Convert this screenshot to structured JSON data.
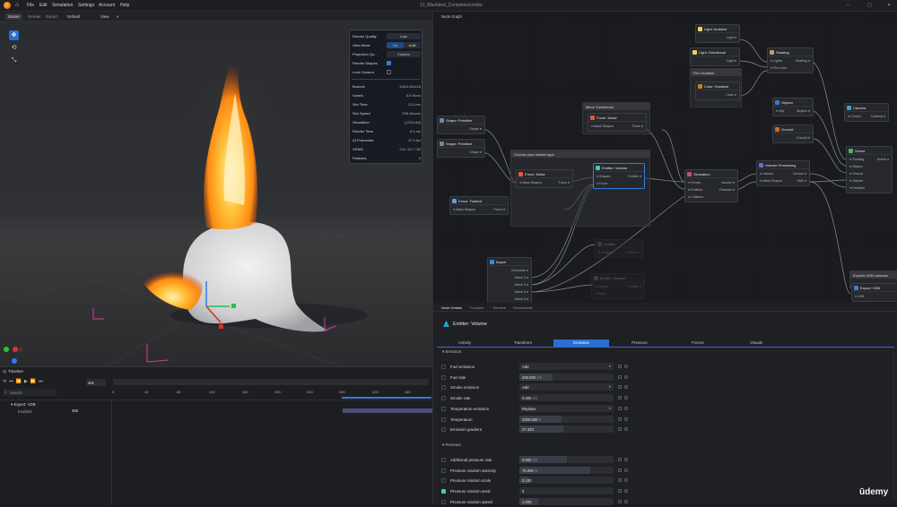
{
  "app": {
    "window_title": "13_Blackbird_Completed.embe",
    "menu": [
      "File",
      "Edit",
      "Simulation",
      "Settings",
      "Account",
      "Help"
    ]
  },
  "viewport_tabs": {
    "items": [
      "Scene",
      "Render",
      "Export"
    ],
    "preset": "Default",
    "view_menu": "View"
  },
  "render_panel": {
    "rows": [
      {
        "label": "Render Quality",
        "value": "Low"
      },
      {
        "label": "View Mode",
        "options": [
          "Lit",
          "Unlit"
        ],
        "selected": "Lit"
      },
      {
        "label": "Projection Qu...",
        "value": "Custom"
      },
      {
        "label": "Render Shapes",
        "checked": true
      },
      {
        "label": "Lock Camera",
        "checked": false
      }
    ],
    "stats": [
      {
        "label": "Bounds",
        "value": "128x128x416"
      },
      {
        "label": "Voxels",
        "value": "6.8 Mvox"
      },
      {
        "label": "Sim Time",
        "value": "12.8 ms"
      },
      {
        "label": "Sim Speed",
        "value": "536 Mvox/s"
      },
      {
        "label": "Simulation",
        "value": "(1231x48)"
      },
      {
        "label": "Render Time",
        "value": "6.6 ms"
      },
      {
        "label": "UI Framerate",
        "value": "47.9 fps"
      },
      {
        "label": "VRAM",
        "value": "9.6 / 15.7 GB"
      },
      {
        "label": "Particles",
        "value": "0"
      }
    ]
  },
  "viewport_gizmo": {
    "x_label": "-X"
  },
  "timeline": {
    "title": "Timeline",
    "frame_value": "451",
    "search_placeholder": "Search",
    "ticks": [
      "0",
      "40",
      "80",
      "120",
      "160",
      "200",
      "240",
      "280",
      "320",
      "360"
    ],
    "tracks": [
      {
        "name": "Export: VDB",
        "value": ""
      },
      {
        "name": "Enabled",
        "value": "256"
      }
    ]
  },
  "node_graph": {
    "title": "Node Graph",
    "groups": [
      "Fire Gradient",
      "Minor Turbulence",
      "Choose your emitter type",
      "Exports VDB volumes"
    ],
    "nodes": [
      {
        "title": "Light: Ambient",
        "ports_out": [
          "Light"
        ]
      },
      {
        "title": "Light: Directional",
        "ports_out": [
          "Light"
        ]
      },
      {
        "title": "Color: Gradient",
        "ports_out": [
          "Color"
        ]
      },
      {
        "title": "Shading",
        "ports_in": [
          "Lights",
          "Fire color"
        ],
        "ports_out": [
          "Shading"
        ]
      },
      {
        "title": "Skybox",
        "ports_in": [
          "Sky"
        ],
        "ports_out": [
          "Skybox"
        ]
      },
      {
        "title": "Ground",
        "ports_out": [
          "Ground"
        ]
      },
      {
        "title": "Camera",
        "ports_in": [
          "Control"
        ],
        "ports_out": [
          "Camera"
        ]
      },
      {
        "title": "Scene",
        "ports_in": [
          "Shading",
          "Skybox",
          "Ground",
          "Volume",
          "Particles"
        ],
        "ports_out": [
          "Scene"
        ]
      },
      {
        "title": "Shape: Primitive",
        "ports_out": [
          "Shape"
        ]
      },
      {
        "title": "Shape: Primitive",
        "ports_out": [
          "Shape"
        ]
      },
      {
        "title": "Force: Noise",
        "ports_in": [
          "Mask Shapes"
        ],
        "ports_out": [
          "Force"
        ]
      },
      {
        "title": "Force: Noise",
        "ports_in": [
          "Mask Shapes"
        ],
        "ports_out": [
          "Force"
        ]
      },
      {
        "title": "Emitter: Volume",
        "ports_in": [
          "Shapes",
          "Force"
        ],
        "ports_out": [
          "Emitter"
        ]
      },
      {
        "title": "Force: Twisted",
        "ports_in": [
          "Mask Shapes"
        ],
        "ports_out": [
          "Force"
        ]
      },
      {
        "title": "Simulation",
        "ports_in": [
          "Forces",
          "Emitters",
          "Colliders"
        ],
        "ports_out": [
          "Volume",
          "Particles"
        ]
      },
      {
        "title": "Volume Processing",
        "ports_in": [
          "Volume",
          "Mask Shapes"
        ],
        "ports_out": [
          "Volume",
          "VDB"
        ]
      },
      {
        "title": "Import",
        "ports_out": [
          "Geometry",
          "Mesh 1",
          "Mesh 2",
          "Mesh 3",
          "Mesh 4"
        ]
      },
      {
        "title": "Collider",
        "ports_in": [
          "Shapes"
        ],
        "ports_out": [
          "Collider"
        ]
      },
      {
        "title": "Emitter: Volume",
        "ports_in": [
          "Shapes",
          "Force"
        ],
        "ports_out": [
          "Emitter"
        ]
      },
      {
        "title": "Export: VDB",
        "ports_in": [
          "VDB"
        ]
      }
    ]
  },
  "details": {
    "tabs": [
      "Node Details",
      "Function",
      "Timeline",
      "Renderstats"
    ],
    "node_title": "Emitter: Volume",
    "subtabs": [
      "Activity",
      "Transform",
      "Emission",
      "Pressure",
      "Forces",
      "Visuals"
    ],
    "active_subtab": "Emission",
    "sections": [
      {
        "title": "Emission",
        "rows": [
          {
            "label": "Fuel emission",
            "value": "Add",
            "kind": "dropdown",
            "checked": false
          },
          {
            "label": "Fuel rate",
            "value": "200.000",
            "unit": "1/s",
            "fill": 0.35,
            "checked": false
          },
          {
            "label": "Smoke emission",
            "value": "Add",
            "kind": "dropdown",
            "checked": false
          },
          {
            "label": "Smoke rate",
            "value": "0.000",
            "unit": "1/s",
            "fill": 0,
            "checked": false
          },
          {
            "label": "Temperature emission",
            "value": "Replace",
            "kind": "dropdown",
            "checked": false
          },
          {
            "label": "Temperature",
            "value": "2000.000",
            "unit": "K",
            "fill": 0.45,
            "checked": false
          },
          {
            "label": "Emission gradient",
            "value": "47.333",
            "fill": 0.47,
            "checked": false
          }
        ]
      },
      {
        "title": "Pressure",
        "rows": [
          {
            "label": "Additional pressure rate",
            "value": "0.000",
            "unit": "1/s",
            "fill": 0.5,
            "checked": false
          },
          {
            "label": "Pressure random intensity",
            "value": "75.000",
            "unit": "%",
            "fill": 0.75,
            "checked": false
          },
          {
            "label": "Pressure random scale",
            "value": "0.100",
            "fill": 0.1,
            "checked": false
          },
          {
            "label": "Pressure random seed",
            "value": "3",
            "fill": 0,
            "checked": true
          },
          {
            "label": "Pressure random speed",
            "value": "1.000",
            "fill": 0.2,
            "checked": false
          }
        ]
      }
    ]
  },
  "watermark": "ūdemy",
  "colors": {
    "accent": "#2a6fd0",
    "check": "#3fc9c0",
    "fire": "#ff9a1a"
  }
}
